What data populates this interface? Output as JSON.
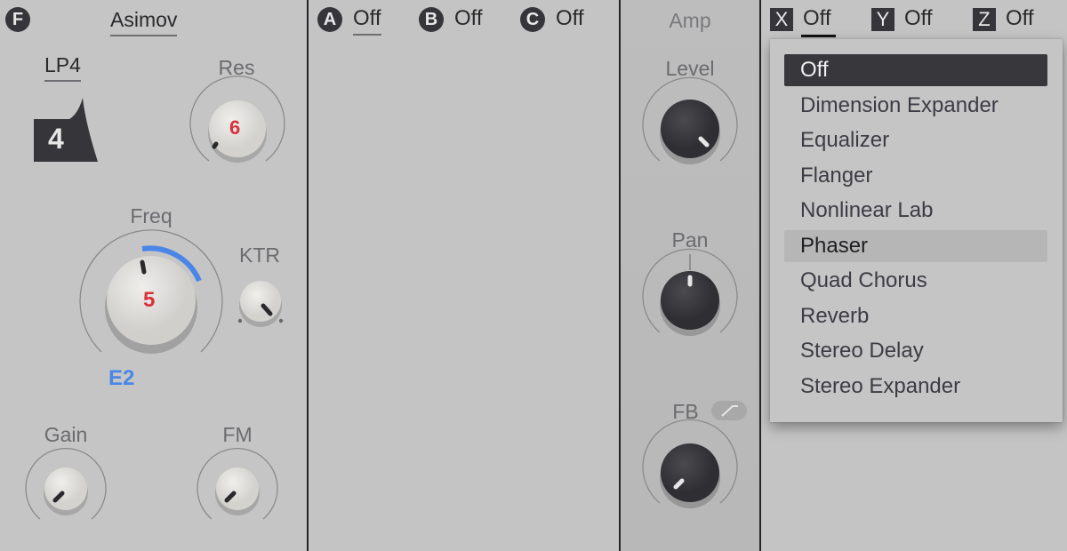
{
  "filter": {
    "badge": "F",
    "model": "Asimov",
    "type": "LP4",
    "slope_icon_value": "4",
    "res": {
      "label": "Res",
      "value": "6"
    },
    "freq": {
      "label": "Freq",
      "value": "5",
      "note": "E2"
    },
    "ktr": {
      "label": "KTR"
    },
    "gain": {
      "label": "Gain"
    },
    "fm": {
      "label": "FM"
    }
  },
  "fx_slots": [
    {
      "badge": "A",
      "value": "Off"
    },
    {
      "badge": "B",
      "value": "Off"
    },
    {
      "badge": "C",
      "value": "Off"
    }
  ],
  "amp": {
    "title": "Amp",
    "level": {
      "label": "Level"
    },
    "pan": {
      "label": "Pan"
    },
    "fb": {
      "label": "FB",
      "toggle_icon": "curve-icon"
    }
  },
  "fx2_slots": [
    {
      "badge": "X",
      "value": "Off"
    },
    {
      "badge": "Y",
      "value": "Off"
    },
    {
      "badge": "Z",
      "value": "Off"
    }
  ],
  "dropdown": {
    "selected": "Off",
    "hovered": "Phaser",
    "items": [
      "Off",
      "Dimension Expander",
      "Equalizer",
      "Flanger",
      "Nonlinear Lab",
      "Phaser",
      "Quad Chorus",
      "Reverb",
      "Stereo Delay",
      "Stereo Expander"
    ]
  },
  "colors": {
    "value_red": "#d7323c",
    "accent_blue": "#4a86e8",
    "dark": "#36363a"
  }
}
